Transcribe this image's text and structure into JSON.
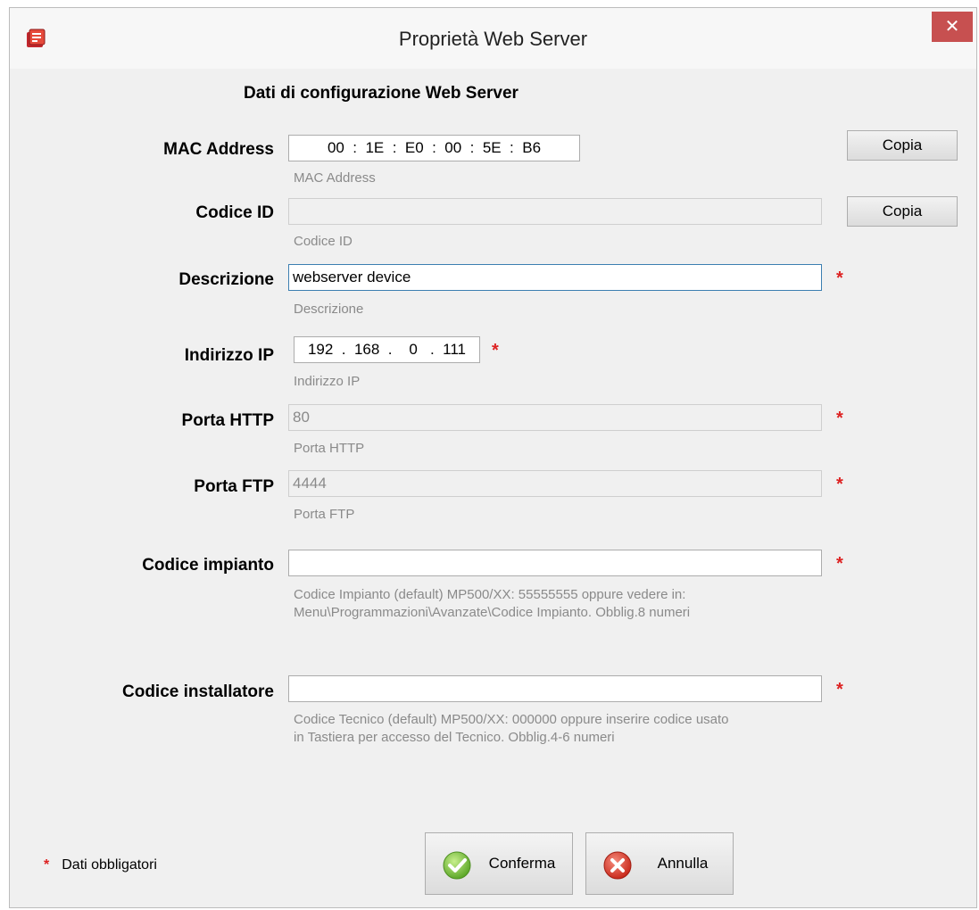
{
  "window": {
    "title": "Proprietà Web Server",
    "close_glyph": "✕"
  },
  "form": {
    "heading": "Dati di configurazione Web Server",
    "mac": {
      "label": "MAC Address",
      "value": "00  :  1E  :  E0  :  00  :  5E  :  B6",
      "hint": "MAC Address",
      "copy_label": "Copia"
    },
    "codice_id": {
      "label": "Codice ID",
      "value": "",
      "hint": "Codice ID",
      "copy_label": "Copia"
    },
    "descrizione": {
      "label": "Descrizione",
      "value": "webserver device",
      "hint": "Descrizione",
      "required": "*"
    },
    "indirizzo_ip": {
      "label": "Indirizzo IP",
      "value": "192  .  168  .    0   .  111",
      "hint": "Indirizzo IP",
      "required": "*"
    },
    "porta_http": {
      "label": "Porta HTTP",
      "value": "80",
      "hint": "Porta HTTP",
      "required": "*"
    },
    "porta_ftp": {
      "label": "Porta FTP",
      "value": "4444",
      "hint": "Porta FTP",
      "required": "*"
    },
    "codice_impianto": {
      "label": "Codice impianto",
      "value": "",
      "hint_line1": "Codice Impianto (default) MP500/XX: 55555555 oppure vedere in:",
      "hint_line2": "Menu\\Programmazioni\\Avanzate\\Codice Impianto. Obblig.8 numeri",
      "required": "*"
    },
    "codice_installatore": {
      "label": "Codice installatore",
      "value": "",
      "hint_line1": "Codice Tecnico (default) MP500/XX: 000000 oppure inserire codice usato",
      "hint_line2": "in Tastiera per accesso del Tecnico. Obblig.4-6 numeri",
      "required": "*"
    }
  },
  "footer": {
    "required_star": "*",
    "legend": "Dati obbligatori",
    "confirm_label": "Conferma",
    "cancel_label": "Annulla"
  },
  "colors": {
    "required": "#dd2222",
    "close_button": "#c75050",
    "confirm_icon": "#7cc242",
    "cancel_icon": "#d33a2c"
  },
  "icons": {
    "app": "app-icon",
    "close": "close-icon",
    "confirm": "check-icon",
    "cancel": "cancel-x-icon"
  }
}
